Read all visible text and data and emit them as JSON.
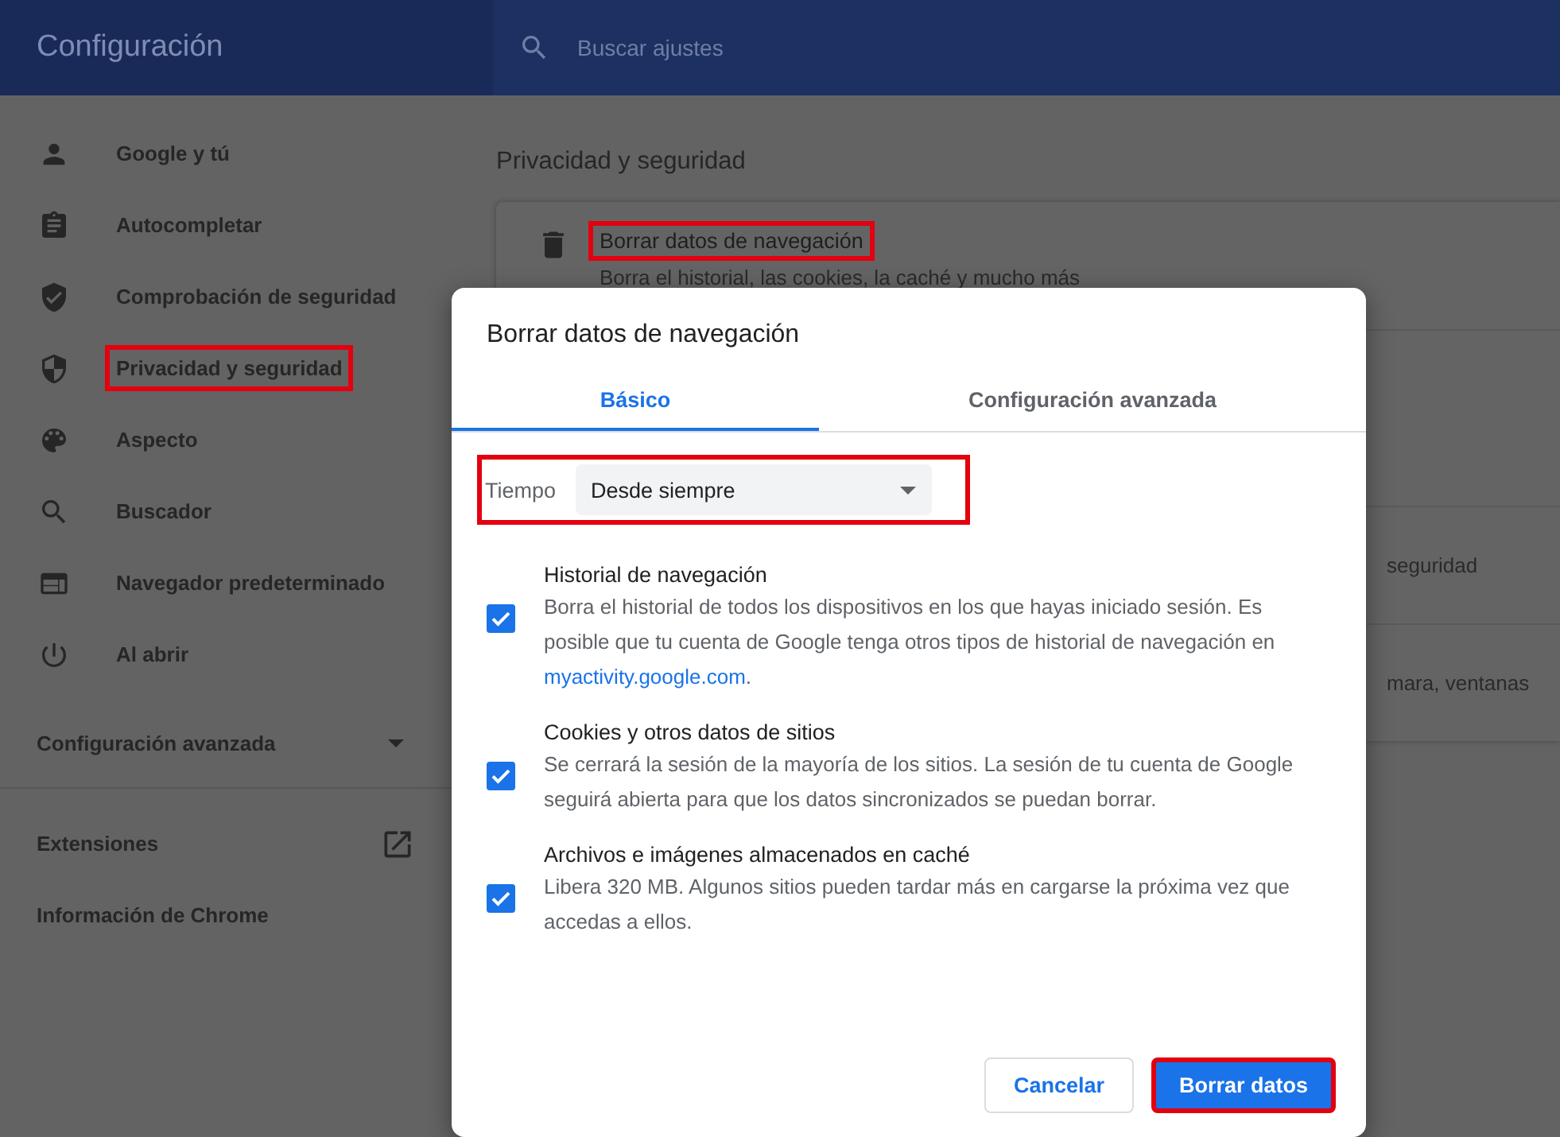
{
  "header": {
    "title": "Configuración",
    "search": {
      "placeholder": "Buscar ajustes"
    }
  },
  "sidebar": {
    "items": [
      {
        "label": "Google y tú",
        "highlighted": false
      },
      {
        "label": "Autocompletar",
        "highlighted": false
      },
      {
        "label": "Comprobación de seguridad",
        "highlighted": false
      },
      {
        "label": "Privacidad y seguridad",
        "highlighted": true
      },
      {
        "label": "Aspecto",
        "highlighted": false
      },
      {
        "label": "Buscador",
        "highlighted": false
      },
      {
        "label": "Navegador predeterminado",
        "highlighted": false
      },
      {
        "label": "Al abrir",
        "highlighted": false
      }
    ],
    "advanced": {
      "label": "Configuración avanzada",
      "expanded": false
    },
    "links": [
      {
        "label": "Extensiones",
        "kind": "external"
      },
      {
        "label": "Información de Chrome",
        "kind": "plain"
      }
    ]
  },
  "main": {
    "section_title": "Privacidad y seguridad",
    "card": {
      "title": "Borrar datos de navegación",
      "subtitle": "Borra el historial, las cookies, la caché y mucho más",
      "highlighted": true
    },
    "partial_rows": [
      "seguridad",
      "mara, ventanas"
    ]
  },
  "dialog": {
    "title": "Borrar datos de navegación",
    "tabs": [
      {
        "label": "Básico",
        "selected": true
      },
      {
        "label": "Configuración avanzada",
        "selected": false
      }
    ],
    "time": {
      "label": "Tiempo",
      "value": "Desde siempre",
      "highlighted": true
    },
    "options": [
      {
        "title": "Historial de navegación",
        "text": "Borra el historial de todos los dispositivos en los que hayas iniciado sesión. Es posible que tu cuenta de Google tenga otros tipos de historial de navegación en ",
        "link": "myactivity.google.com",
        "text_after": ".",
        "checked": true
      },
      {
        "title": "Cookies y otros datos de sitios",
        "text": "Se cerrará la sesión de la mayoría de los sitios. La sesión de tu cuenta de Google seguirá abierta para que los datos sincronizados se puedan borrar.",
        "checked": true
      },
      {
        "title": "Archivos e imágenes almacenados en caché",
        "text": "Libera 320 MB. Algunos sitios pueden tardar más en cargarse la próxima vez que accedas a ellos.",
        "checked": true
      }
    ],
    "buttons": [
      {
        "label": "Cancelar",
        "kind": "secondary",
        "highlighted": false
      },
      {
        "label": "Borrar datos",
        "kind": "primary",
        "highlighted": true
      }
    ]
  }
}
